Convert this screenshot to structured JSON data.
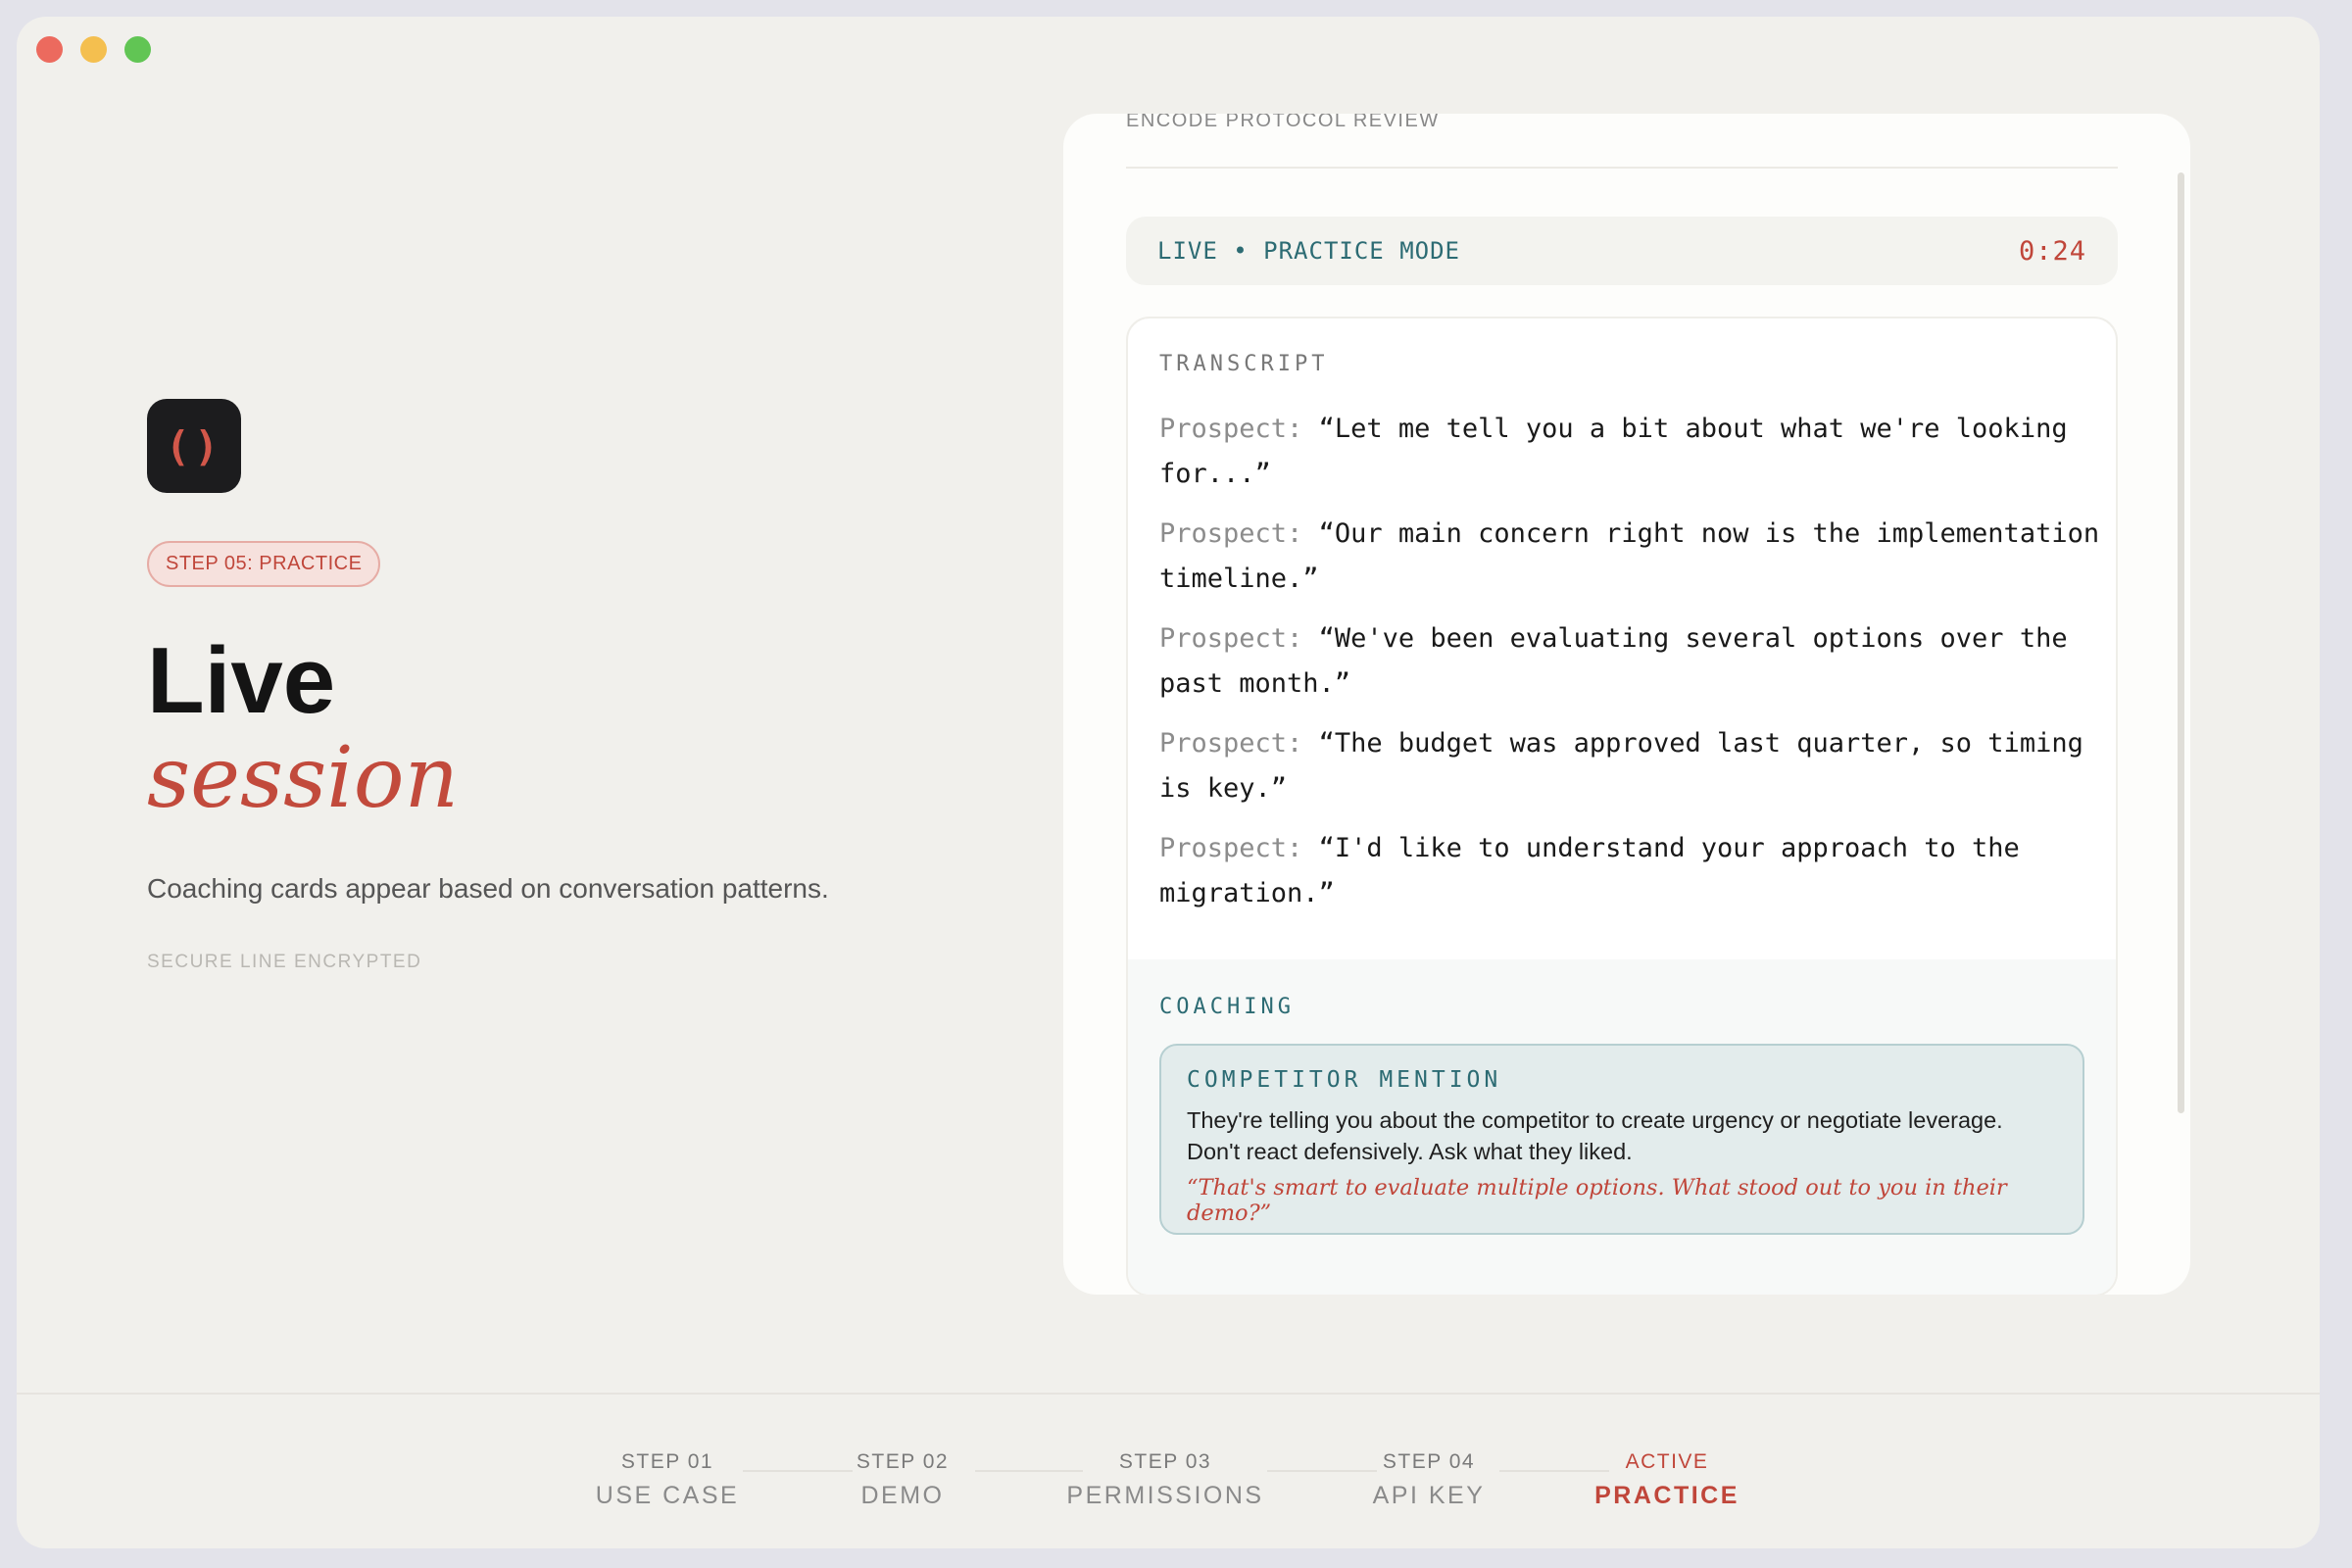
{
  "window": {
    "traffic_lights": [
      "close",
      "minimize",
      "zoom"
    ]
  },
  "left": {
    "logo_glyph": "()",
    "step_badge": "STEP 05: PRACTICE",
    "title_line1": "Live",
    "title_line2": "session",
    "subtitle": "Coaching cards appear based on conversation patterns.",
    "secure_label": "SECURE LINE ENCRYPTED"
  },
  "card": {
    "header": "ENCODE PROTOCOL REVIEW",
    "live_label": "LIVE • PRACTICE MODE",
    "timer": "0:24",
    "transcript_heading": "TRANSCRIPT",
    "transcript": [
      {
        "speaker": "Prospect:",
        "text": "“Let me tell you a bit about what we're looking for...”"
      },
      {
        "speaker": "Prospect:",
        "text": "“Our main concern right now is the implementation timeline.”"
      },
      {
        "speaker": "Prospect:",
        "text": "“We've been evaluating several options over the past month.”"
      },
      {
        "speaker": "Prospect:",
        "text": "“The budget was approved last quarter, so timing is key.”"
      },
      {
        "speaker": "Prospect:",
        "text": "“I'd like to understand your approach to the migration.”"
      }
    ],
    "coaching_heading": "COACHING",
    "coach_card": {
      "title": "COMPETITOR MENTION",
      "body": "They're telling you about the competitor to create urgency or negotiate leverage. Don't react defensively. Ask what they liked.",
      "quote": "“That's smart to evaluate multiple options. What stood out to you in their demo?”"
    }
  },
  "stepper": {
    "steps": [
      {
        "num": "STEP 01",
        "name": "USE CASE"
      },
      {
        "num": "STEP 02",
        "name": "DEMO"
      },
      {
        "num": "STEP 03",
        "name": "PERMISSIONS"
      },
      {
        "num": "STEP 04",
        "name": "API KEY"
      },
      {
        "num": "ACTIVE",
        "name": "PRACTICE"
      }
    ],
    "active_index": 4
  },
  "colors": {
    "accent": "#c0463a",
    "teal": "#2c6b73",
    "window_bg": "#f1f0ec"
  }
}
